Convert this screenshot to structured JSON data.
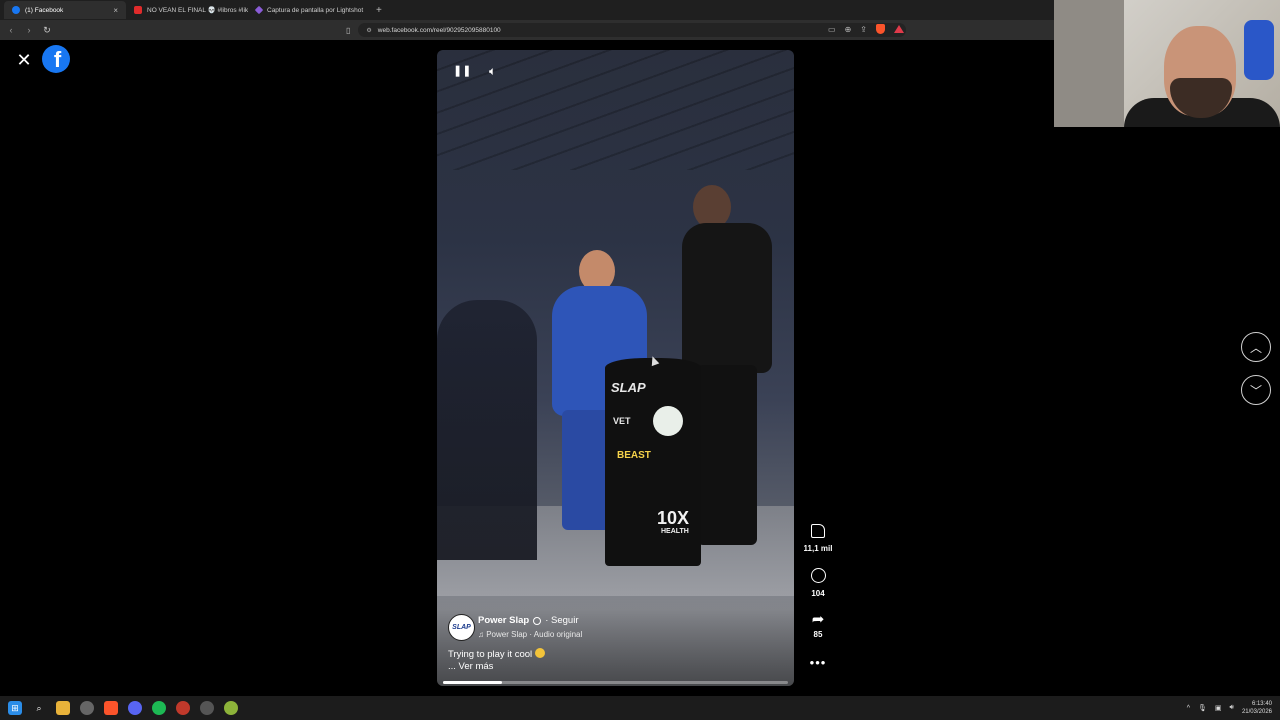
{
  "browser": {
    "tabs": [
      {
        "title": "(1) Facebook",
        "active": true
      },
      {
        "title": "NO VEAN EL FINAL 💀 #libros #lik...",
        "active": false
      },
      {
        "title": "Captura de pantalla por Lightshot",
        "active": false
      }
    ],
    "new_tab": "+",
    "url": "web.facebook.com/reel/902952095880100",
    "tab_close": "×"
  },
  "page": {
    "close": "✕",
    "logo_letter": "f"
  },
  "video": {
    "author": "Power Slap",
    "follow": "· Seguir",
    "audio": "♫ Power Slap · Audio original",
    "caption": "Trying to play it cool",
    "more": "... Ver más",
    "avatar_text": "SLAP",
    "progress": 0.17,
    "podium": {
      "brand": "SLAP",
      "vet": "VET",
      "beast": "BEAST",
      "ten": "10X",
      "health": "HEALTH"
    }
  },
  "actions": {
    "likes": "11,1 mil",
    "comments": "104",
    "shares": "85",
    "more": "•••"
  },
  "taskbar": {
    "time": "6:13:40",
    "date": "21/03/2026"
  },
  "colors": {
    "facebook_blue": "#1877f2",
    "background": "#000000"
  }
}
